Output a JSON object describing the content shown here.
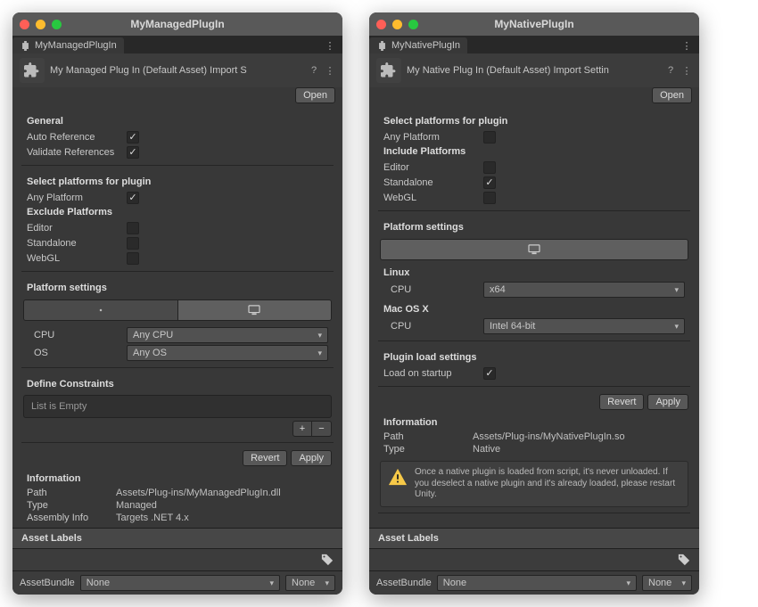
{
  "left": {
    "windowTitle": "MyManagedPlugIn",
    "tabName": "MyManagedPlugIn",
    "headerTitle": "My Managed Plug In (Default Asset) Import S",
    "openBtn": "Open",
    "general": {
      "title": "General",
      "autoRef": "Auto Reference",
      "validate": "Validate References"
    },
    "select": {
      "title": "Select platforms for plugin",
      "any": "Any Platform",
      "exclude": "Exclude Platforms",
      "editor": "Editor",
      "standalone": "Standalone",
      "webgl": "WebGL"
    },
    "platform": {
      "title": "Platform settings",
      "cpu": "CPU",
      "cpuVal": "Any CPU",
      "os": "OS",
      "osVal": "Any OS"
    },
    "define": {
      "title": "Define Constraints",
      "empty": "List is Empty"
    },
    "actions": {
      "revert": "Revert",
      "apply": "Apply"
    },
    "info": {
      "title": "Information",
      "path": "Path",
      "pathVal": "Assets/Plug-ins/MyManagedPlugIn.dll",
      "type": "Type",
      "typeVal": "Managed",
      "asm": "Assembly Info",
      "asmVal": "Targets .NET 4.x"
    },
    "assetLabels": "Asset Labels",
    "bundle": {
      "label": "AssetBundle",
      "a": "None",
      "b": "None"
    }
  },
  "right": {
    "windowTitle": "MyNativePlugIn",
    "tabName": "MyNativePlugIn",
    "headerTitle": "My Native Plug In (Default Asset) Import Settin",
    "openBtn": "Open",
    "select": {
      "title": "Select platforms for plugin",
      "any": "Any Platform",
      "include": "Include Platforms",
      "editor": "Editor",
      "standalone": "Standalone",
      "webgl": "WebGL"
    },
    "platform": {
      "title": "Platform settings",
      "linux": "Linux",
      "linuxCpu": "CPU",
      "linuxCpuVal": "x64",
      "mac": "Mac OS X",
      "macCpu": "CPU",
      "macCpuVal": "Intel 64-bit"
    },
    "load": {
      "title": "Plugin load settings",
      "startup": "Load on startup"
    },
    "actions": {
      "revert": "Revert",
      "apply": "Apply"
    },
    "info": {
      "title": "Information",
      "path": "Path",
      "pathVal": "Assets/Plug-ins/MyNativePlugIn.so",
      "type": "Type",
      "typeVal": "Native"
    },
    "warning": "Once a native plugin is loaded from script, it's never unloaded. If you deselect a native plugin and it's already loaded, please restart Unity.",
    "assetLabels": "Asset Labels",
    "bundle": {
      "label": "AssetBundle",
      "a": "None",
      "b": "None"
    }
  }
}
